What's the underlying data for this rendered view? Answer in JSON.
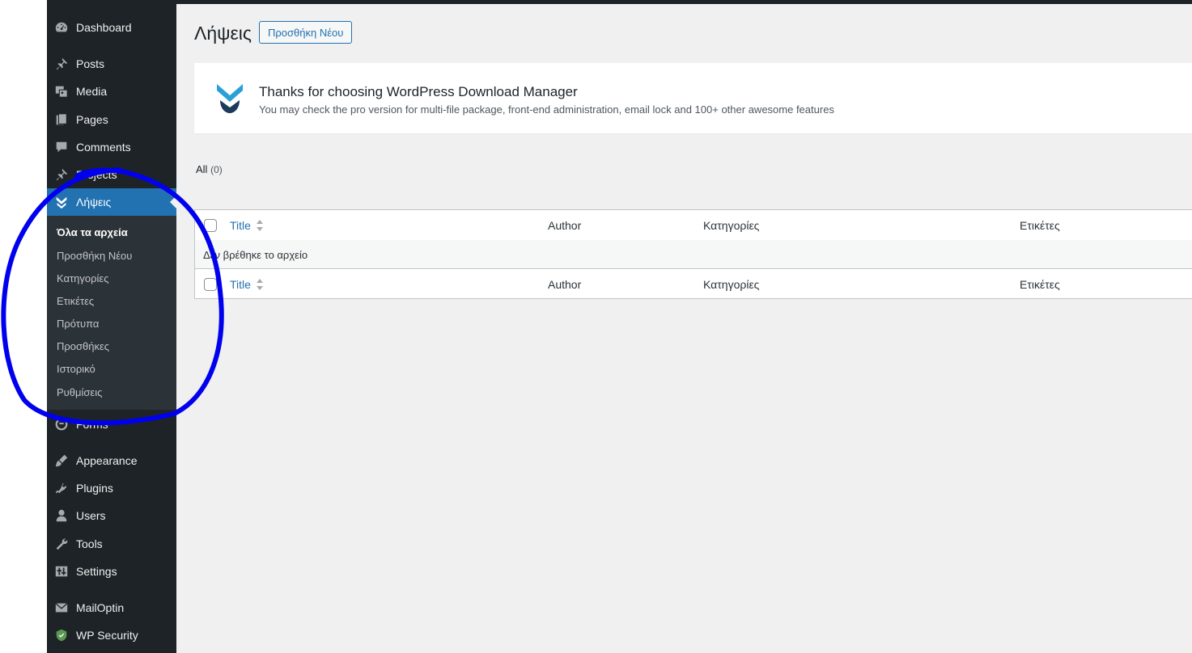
{
  "sidebar": {
    "items": [
      {
        "label": "Dashboard",
        "icon": "dashboard-icon"
      },
      {
        "label": "Posts",
        "icon": "pin-icon"
      },
      {
        "label": "Media",
        "icon": "media-icon"
      },
      {
        "label": "Pages",
        "icon": "pages-icon"
      },
      {
        "label": "Comments",
        "icon": "comments-icon"
      },
      {
        "label": "Projects",
        "icon": "pin-icon"
      },
      {
        "label": "Λήψεις",
        "icon": "download-icon"
      },
      {
        "label": "Forms",
        "icon": "forms-icon"
      },
      {
        "label": "Appearance",
        "icon": "brush-icon"
      },
      {
        "label": "Plugins",
        "icon": "plugin-icon"
      },
      {
        "label": "Users",
        "icon": "user-icon"
      },
      {
        "label": "Tools",
        "icon": "wrench-icon"
      },
      {
        "label": "Settings",
        "icon": "settings-icon"
      },
      {
        "label": "MailOptin",
        "icon": "mail-icon"
      },
      {
        "label": "WP Security",
        "icon": "shield-icon"
      }
    ],
    "submenu": [
      "Όλα τα αρχεία",
      "Προσθήκη Νέου",
      "Κατηγορίες",
      "Ετικέτες",
      "Πρότυπα",
      "Προσθήκες",
      "Ιστορικό",
      "Ρυθμίσεις"
    ]
  },
  "page": {
    "title": "Λήψεις",
    "add_new_label": "Προσθήκη Νέου"
  },
  "notice": {
    "title": "Thanks for choosing WordPress Download Manager",
    "description": "You may check the pro version for multi-file package, front-end administration, email lock and 100+ other awesome features"
  },
  "views": {
    "all_label": "All",
    "all_count": "(0)"
  },
  "table": {
    "columns": [
      "Title",
      "Author",
      "Κατηγορίες",
      "Ετικέτες"
    ],
    "empty_message": "Δεν βρέθηκε το αρχείο"
  },
  "colors": {
    "sidebar_bg": "#1d2327",
    "submenu_bg": "#2c3338",
    "accent": "#2271b1",
    "content_bg": "#f0f0f1",
    "annotation": "#0000ee"
  }
}
